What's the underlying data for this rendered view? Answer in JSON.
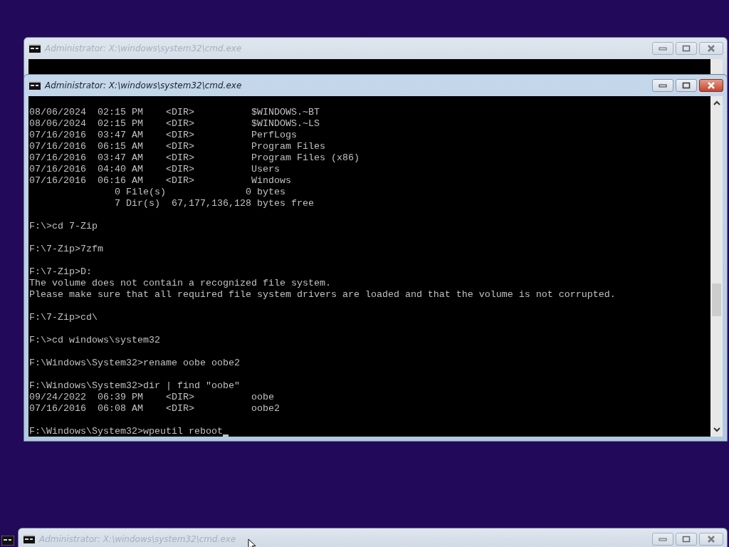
{
  "windows": [
    {
      "title": "Administrator: X:\\windows\\system32\\cmd.exe",
      "active": false
    },
    {
      "title": "Administrator: X:\\windows\\system32\\cmd.exe",
      "active": true,
      "terminal": {
        "cursor": true,
        "blocks": [
          [
            "08/06/2024  02:15 PM    <DIR>          $WINDOWS.~BT",
            "08/06/2024  02:15 PM    <DIR>          $WINDOWS.~LS",
            "07/16/2016  03:47 AM    <DIR>          PerfLogs",
            "07/16/2016  06:15 AM    <DIR>          Program Files",
            "07/16/2016  03:47 AM    <DIR>          Program Files (x86)",
            "07/16/2016  04:40 AM    <DIR>          Users",
            "07/16/2016  06:16 AM    <DIR>          Windows",
            "               0 File(s)              0 bytes",
            "               7 Dir(s)  67,177,136,128 bytes free"
          ],
          [
            "F:\\>cd 7-Zip"
          ],
          [
            "F:\\7-Zip>7zfm"
          ],
          [
            "F:\\7-Zip>D:",
            "The volume does not contain a recognized file system.",
            "Please make sure that all required file system drivers are loaded and that the volume is not corrupted."
          ],
          [
            "F:\\7-Zip>cd\\"
          ],
          [
            "F:\\>cd windows\\system32"
          ],
          [
            "F:\\Windows\\System32>rename oobe oobe2"
          ],
          [
            "F:\\Windows\\System32>dir | find \"oobe\"",
            "09/24/2022  06:39 PM    <DIR>          oobe",
            "07/16/2016  06:08 AM    <DIR>          oobe2"
          ],
          [
            "F:\\Windows\\System32>wpeutil reboot"
          ]
        ]
      }
    },
    {
      "title": "Administrator: X:\\windows\\system32\\cmd.exe",
      "active": false
    }
  ]
}
